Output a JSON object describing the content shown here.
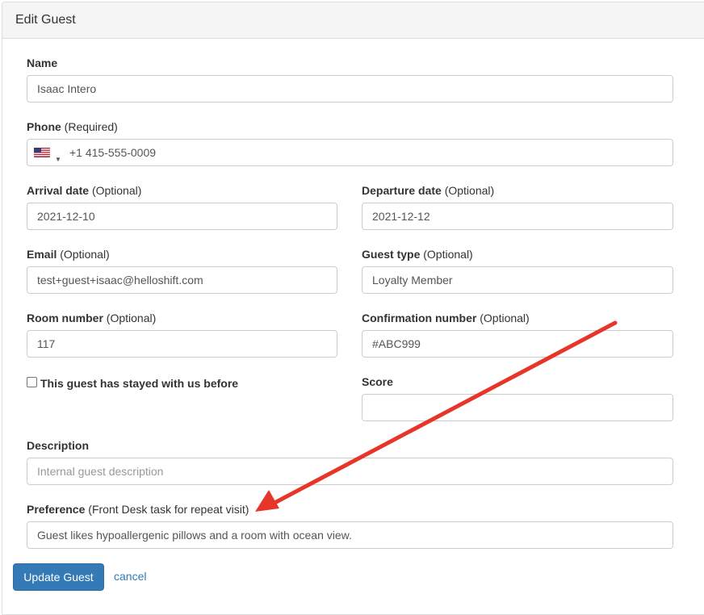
{
  "panel": {
    "title": "Edit Guest"
  },
  "fields": {
    "name": {
      "label": "Name",
      "value": "Isaac Intero"
    },
    "phone": {
      "label": "Phone",
      "qualifier": "(Required)",
      "country_code_icon": "us-flag-icon",
      "value": "+1 415-555-0009"
    },
    "arrival_date": {
      "label": "Arrival date",
      "qualifier": "(Optional)",
      "value": "2021-12-10"
    },
    "departure_date": {
      "label": "Departure date",
      "qualifier": "(Optional)",
      "value": "2021-12-12"
    },
    "email": {
      "label": "Email",
      "qualifier": "(Optional)",
      "value": "test+guest+isaac@helloshift.com"
    },
    "guest_type": {
      "label": "Guest type",
      "qualifier": "(Optional)",
      "value": "Loyalty Member"
    },
    "room_number": {
      "label": "Room number",
      "qualifier": "(Optional)",
      "value": "117"
    },
    "confirmation_number": {
      "label": "Confirmation number",
      "qualifier": "(Optional)",
      "value": "#ABC999"
    },
    "stayed_before": {
      "label": "This guest has stayed with us before",
      "checked": false
    },
    "score": {
      "label": "Score",
      "value": ""
    },
    "description": {
      "label": "Description",
      "value": "",
      "placeholder": "Internal guest description"
    },
    "preference": {
      "label": "Preference",
      "qualifier": "(Front Desk task for repeat visit)",
      "value": "Guest likes hypoallergenic pillows and a room with ocean view."
    }
  },
  "actions": {
    "submit_label": "Update Guest",
    "cancel_label": "cancel"
  },
  "colors": {
    "primary": "#337ab7",
    "annotation_arrow": "#e8352a",
    "heading_bg": "#f5f5f5",
    "border": "#cccccc"
  }
}
